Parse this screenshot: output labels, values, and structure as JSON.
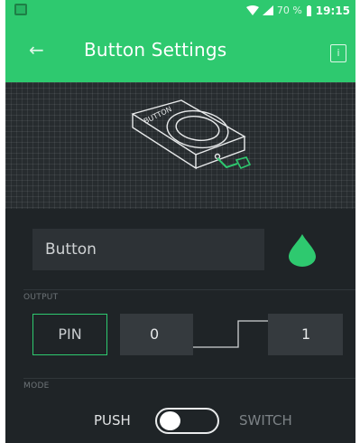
{
  "status_bar": {
    "battery": "70 %",
    "time": "19:15"
  },
  "header": {
    "title": "Button Settings",
    "back_icon": "back-arrow-icon",
    "info_icon": "info-icon"
  },
  "widget": {
    "name": "Button",
    "color": "#2ec96f"
  },
  "output": {
    "section_label": "OUTPUT",
    "pin_label": "PIN",
    "min_value": "0",
    "max_value": "1"
  },
  "mode": {
    "section_label": "MODE",
    "push_label": "PUSH",
    "switch_label": "SWITCH",
    "selected": "PUSH"
  },
  "colors": {
    "accent": "#2ec96f",
    "background": "#1f2427",
    "field": "#2d3236"
  }
}
